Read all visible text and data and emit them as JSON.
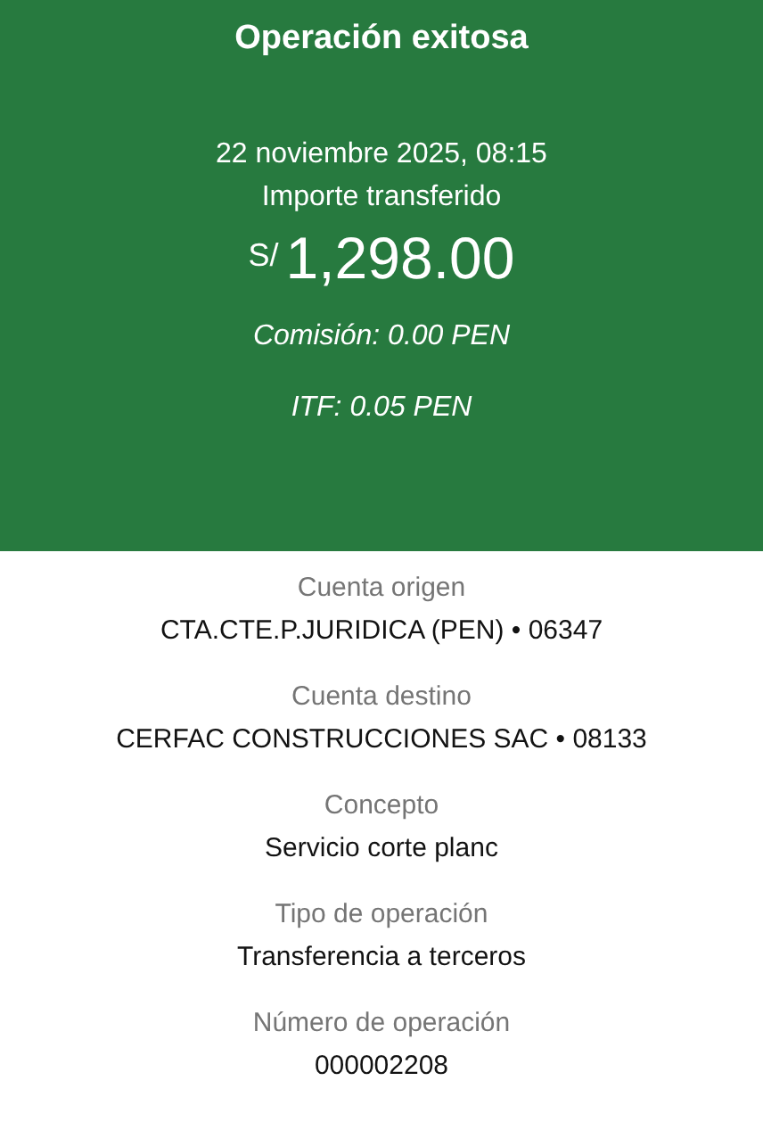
{
  "header": {
    "title": "Operación exitosa",
    "date": "22 noviembre 2025, 08:15",
    "amount_label": "Importe transferido",
    "currency": "S/",
    "amount": "1,298.00",
    "commission": "Comisión: 0.00 PEN",
    "itf": "ITF: 0.05 PEN"
  },
  "details": [
    {
      "label": "Cuenta origen",
      "value": "CTA.CTE.P.JURIDICA (PEN) • 06347"
    },
    {
      "label": "Cuenta destino",
      "value": "CERFAC CONSTRUCCIONES SAC • 08133"
    },
    {
      "label": "Concepto",
      "value": "Servicio corte planc"
    },
    {
      "label": "Tipo de operación",
      "value": "Transferencia a terceros"
    },
    {
      "label": "Número de operación",
      "value": "000002208"
    }
  ]
}
